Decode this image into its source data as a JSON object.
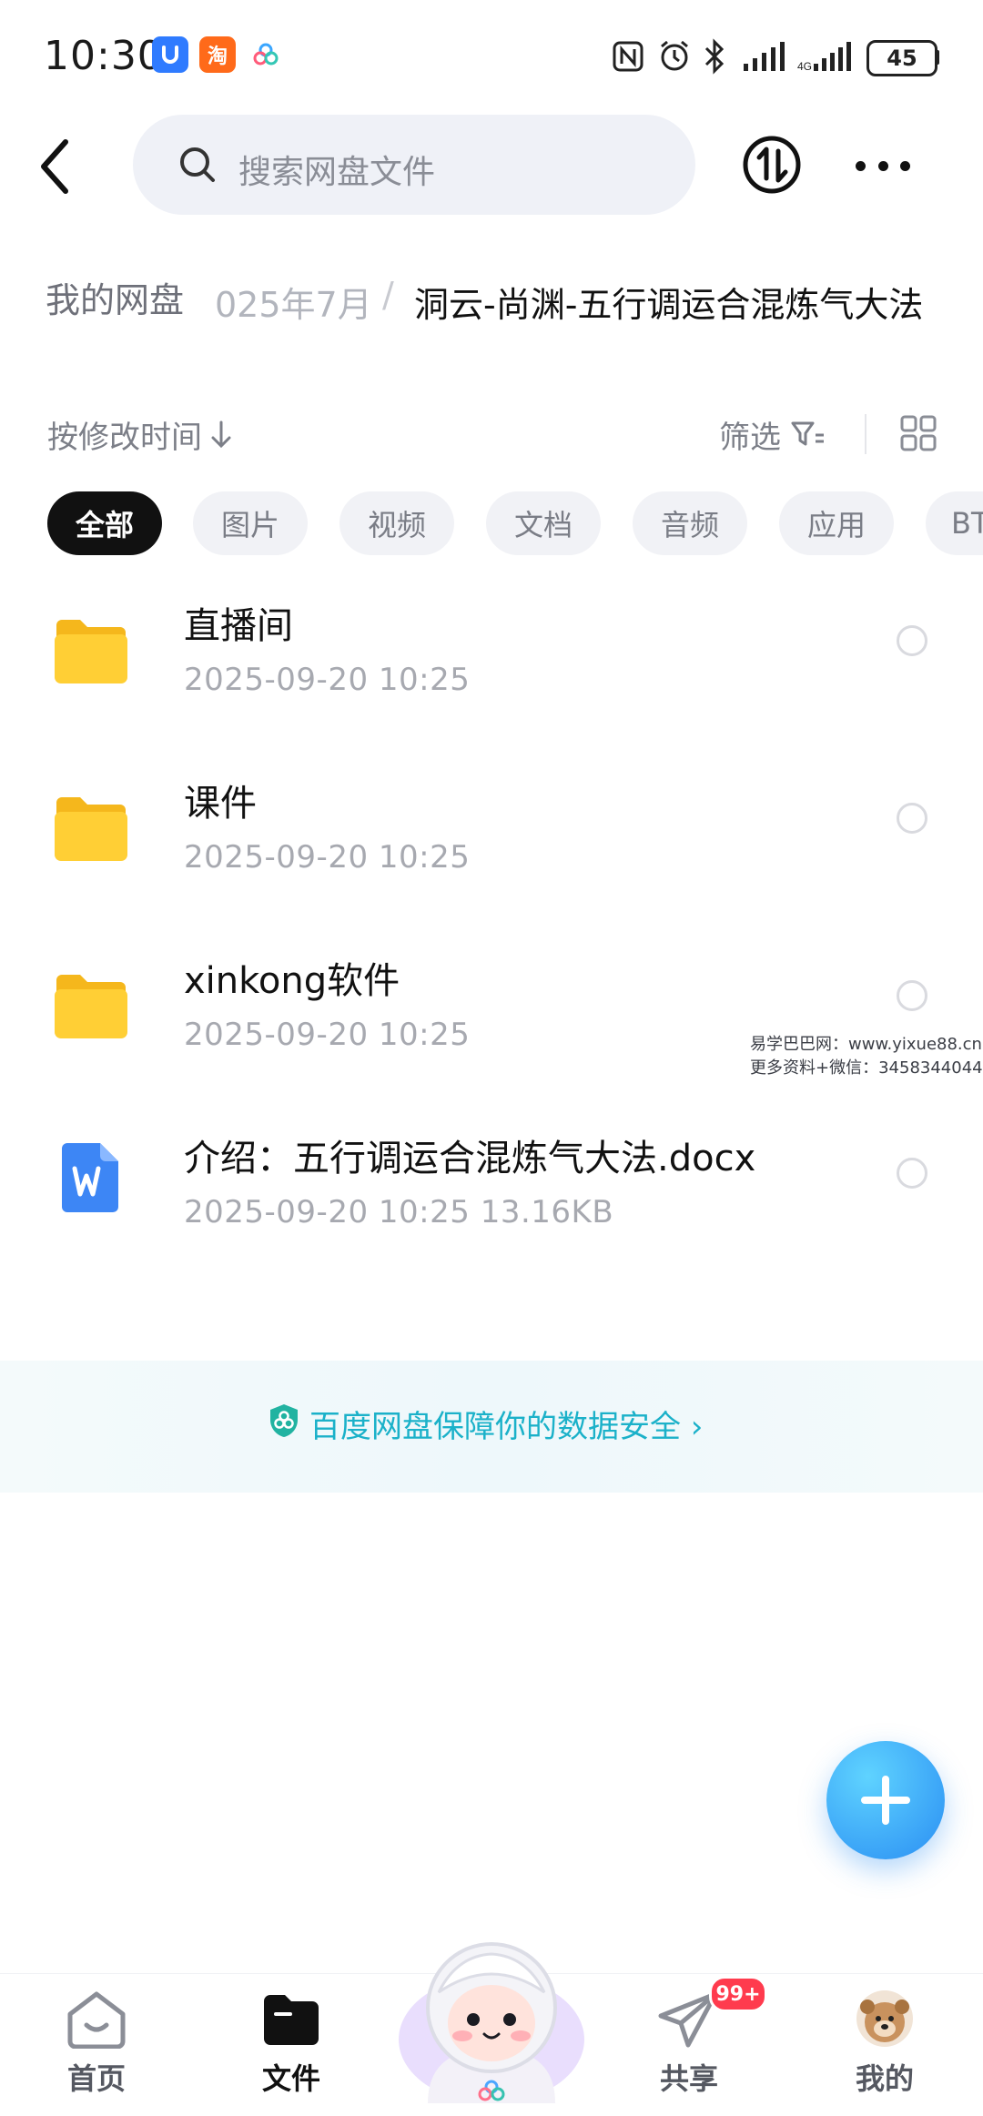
{
  "status_bar": {
    "time": "10:30",
    "battery": "45",
    "apps": [
      {
        "name": "blue-app-icon",
        "glyph": "U",
        "color": "#2f7bff"
      },
      {
        "name": "taobao-icon",
        "glyph": "淘",
        "color": "#ff6a1a"
      },
      {
        "name": "baidu-netdisk-icon",
        "glyph": "",
        "color": "#ffffff"
      }
    ]
  },
  "top_bar": {
    "search_placeholder": "搜索网盘文件"
  },
  "breadcrumb": {
    "root": "我的网盘",
    "middle": "025年7月",
    "separator": "/",
    "current": "洞云-尚渊-五行调运合混炼气大法"
  },
  "toolbar": {
    "sort_label": "按修改时间",
    "filter_label": "筛选"
  },
  "tabs": [
    {
      "label": "全部",
      "active": true
    },
    {
      "label": "图片",
      "active": false
    },
    {
      "label": "视频",
      "active": false
    },
    {
      "label": "文档",
      "active": false
    },
    {
      "label": "音频",
      "active": false
    },
    {
      "label": "应用",
      "active": false
    },
    {
      "label": "BT",
      "active": false
    }
  ],
  "files": [
    {
      "name": "直播间",
      "meta": "2025-09-20  10:25",
      "type": "folder"
    },
    {
      "name": "课件",
      "meta": "2025-09-20  10:25",
      "type": "folder"
    },
    {
      "name": "xinkong软件",
      "meta": "2025-09-20  10:25",
      "type": "folder"
    },
    {
      "name": "介绍：五行调运合混炼气大法.docx",
      "meta": "2025-09-20  10:25   13.16KB",
      "type": "docx"
    }
  ],
  "watermark": {
    "line1": "易学巴巴网：www.yixue88.cn",
    "line2": "更多资料+微信：3458344044"
  },
  "security_banner": {
    "text": "百度网盘保障你的数据安全 ›"
  },
  "bottom_nav": {
    "items": [
      {
        "label": "首页"
      },
      {
        "label": "文件"
      },
      {
        "label": ""
      },
      {
        "label": "共享"
      },
      {
        "label": "我的"
      }
    ],
    "share_badge": "99+"
  },
  "colors": {
    "accent": "#1bb1c9",
    "folder": "#ffc928",
    "docx": "#3d86f5",
    "fab": "#2a8ef3"
  }
}
